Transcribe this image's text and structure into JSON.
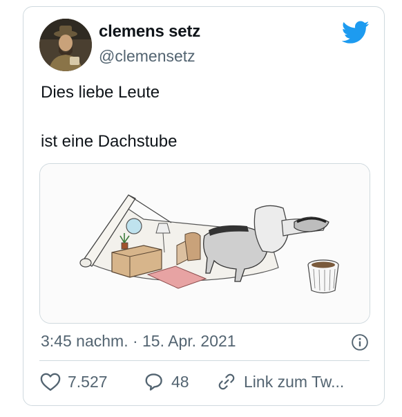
{
  "tweet": {
    "author": {
      "display_name": "clemens setz",
      "handle": "@clemensetz",
      "avatar_icon": "avatar-photo"
    },
    "text_lines": [
      "Dies liebe Leute",
      "ist eine Dachstube"
    ],
    "media": {
      "description_icon": "attic-badger-drawing"
    },
    "timestamp": "3:45 nachm. · 15. Apr. 2021",
    "actions": {
      "likes": "7.527",
      "replies": "48",
      "link_label": "Link zum Tw..."
    },
    "brand_icon": "twitter-bird-icon",
    "colors": {
      "brand": "#1d9bf0",
      "secondary_text": "#536471",
      "border": "#cfd9de"
    }
  }
}
